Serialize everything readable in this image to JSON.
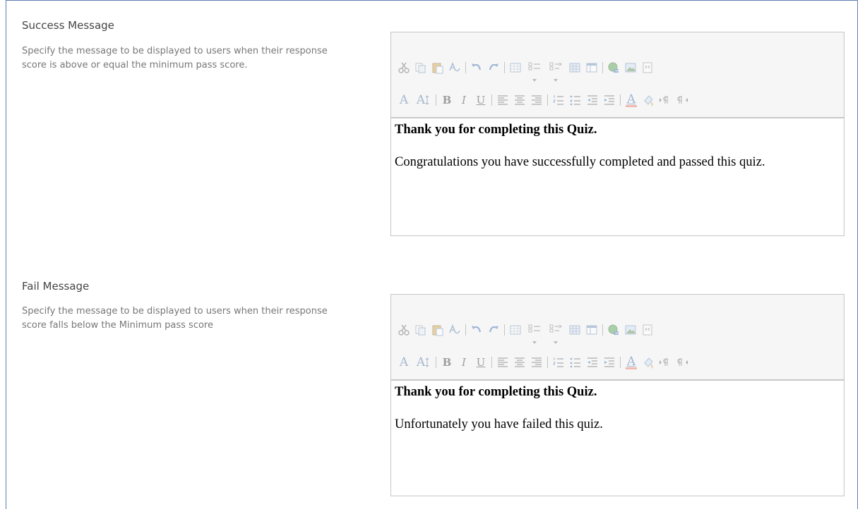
{
  "sections": [
    {
      "title": "Success Message",
      "description": "Specify the message to be displayed to users when their response score is above or equal the minimum pass score.",
      "editor": {
        "heading": "Thank you for completing this Quiz.",
        "body": "Congratulations you have successfully completed and passed this quiz."
      }
    },
    {
      "title": "Fail Message",
      "description": "Specify the message to be displayed to users when their response score falls below the Minimum pass score",
      "editor": {
        "heading": "Thank you for completing this Quiz.",
        "body": "Unfortunately you have failed this quiz."
      }
    }
  ],
  "toolbar": {
    "row1": [
      "cut-icon",
      "copy-icon",
      "paste-icon",
      "spellcheck-icon",
      "undo-icon",
      "redo-icon",
      "insert-table-icon",
      "insert-list-left-icon",
      "insert-list-right-icon",
      "table-grid-icon",
      "table-properties-icon",
      "insert-link-icon",
      "insert-image-icon",
      "html-source-icon"
    ],
    "row2": [
      "font-icon",
      "font-size-icon",
      "bold-icon",
      "italic-icon",
      "underline-icon",
      "align-left-icon",
      "align-center-icon",
      "align-right-icon",
      "numbered-list-icon",
      "bulleted-list-icon",
      "decrease-indent-icon",
      "increase-indent-icon",
      "text-color-icon",
      "highlight-color-icon",
      "ltr-icon",
      "rtl-icon"
    ],
    "letters": {
      "font": "A",
      "font_size": "A",
      "bold": "B",
      "italic": "I",
      "underline": "U",
      "text_color": "A"
    },
    "accent_color": "#4a6f9f",
    "text_color_bar": "#e8735a"
  }
}
